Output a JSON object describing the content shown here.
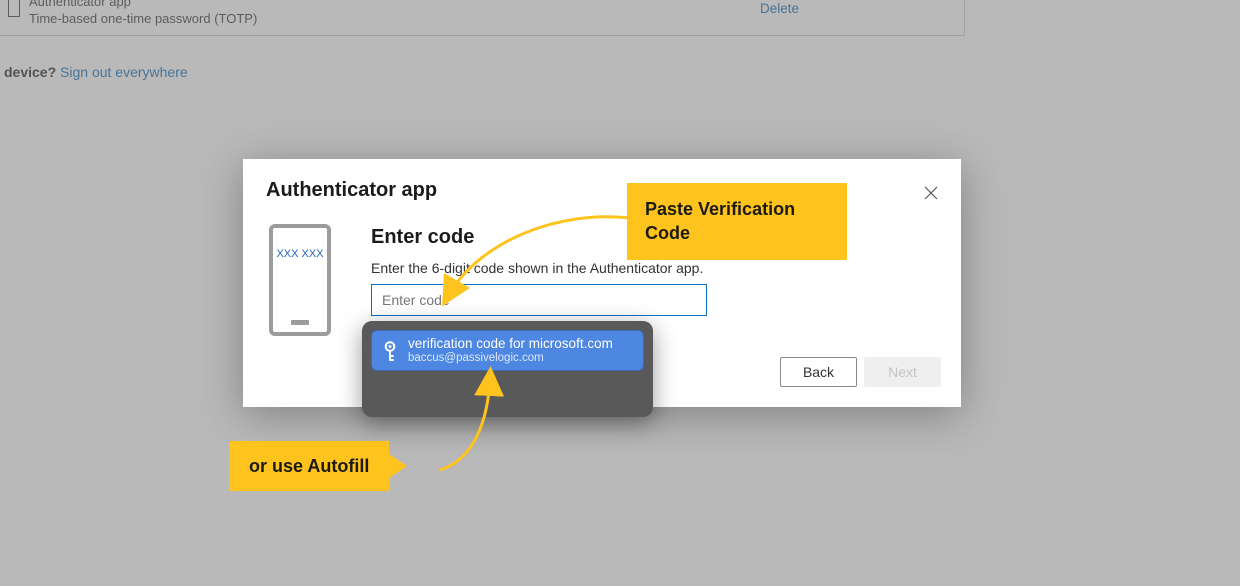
{
  "background": {
    "card_title": "Authenticator app",
    "card_sub": "Time-based one-time password (TOTP)",
    "delete_link": "Delete",
    "device_bold": "device?",
    "signout_link": "Sign out everywhere"
  },
  "modal": {
    "title": "Authenticator app",
    "heading": "Enter code",
    "description": "Enter the 6-digit code shown in the Authenticator app.",
    "input_placeholder": "Enter code",
    "phone_placeholder": "XXX XXX",
    "back_label": "Back",
    "next_label": "Next"
  },
  "autofill": {
    "line1": "verification code for microsoft.com",
    "line2": "baccus@passivelogic.com"
  },
  "callouts": {
    "paste": "Paste Verification Code",
    "autofill": "or use Autofill"
  },
  "colors": {
    "callout_bg": "#fec31d",
    "link_blue": "#0067b8",
    "autofill_bg": "#4d87e1"
  }
}
